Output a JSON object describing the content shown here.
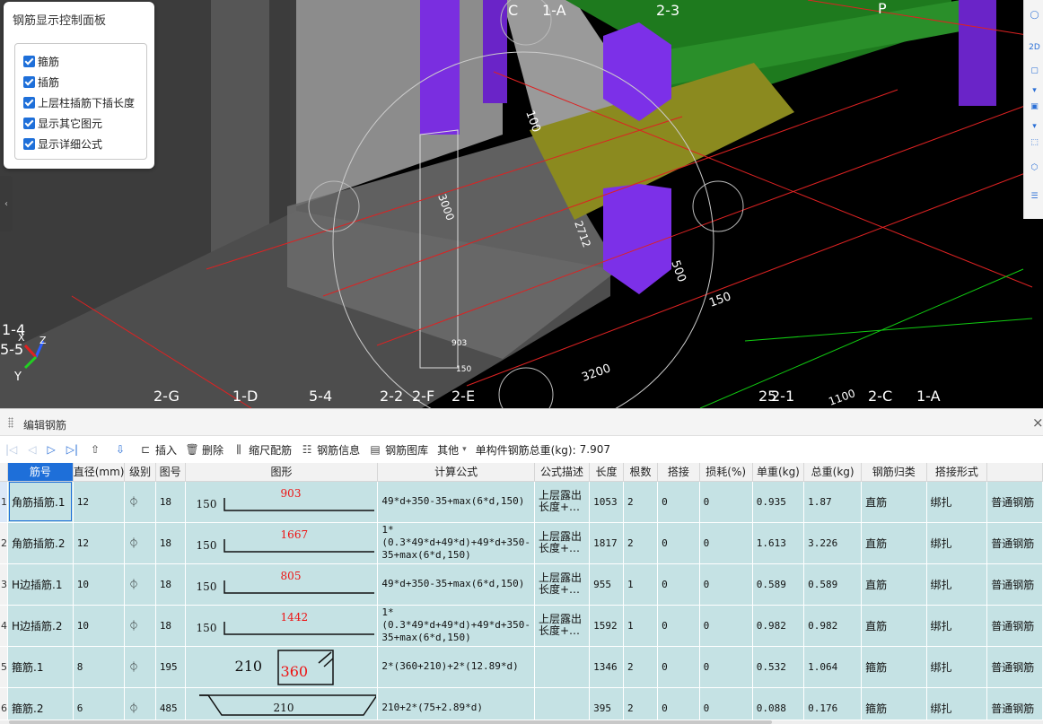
{
  "control_panel": {
    "title": "钢筋显示控制面板",
    "options": [
      {
        "label": "箍筋",
        "checked": true
      },
      {
        "label": "插筋",
        "checked": true
      },
      {
        "label": "上层柱插筋下插长度",
        "checked": true
      },
      {
        "label": "显示其它图元",
        "checked": true
      },
      {
        "label": "显示详细公式",
        "checked": true
      }
    ]
  },
  "viewport": {
    "axis_labels_bottom": [
      "2-G",
      "1-D",
      "5-4",
      "2-2",
      "2-F",
      "2-E",
      "2-1",
      "2-C",
      "1-A"
    ],
    "axis_label_25": "25",
    "axis_labels_top": [
      "C",
      "1-A",
      "2-3",
      "P"
    ],
    "axis_labels_left": [
      "1-4",
      "5-5"
    ],
    "triad": {
      "x": "X",
      "y": "Y",
      "z": "Z"
    },
    "dims": {
      "d903": "903",
      "d150": "150",
      "d500": "500",
      "d150b": "150",
      "d3200": "3200",
      "d100": "100",
      "d3000": "3000",
      "d2712": "2712",
      "d1100": "1100"
    },
    "right_toolbar": {
      "btn2d": "2D"
    }
  },
  "editor": {
    "title": "编辑钢筋",
    "close": "×",
    "toolbar": {
      "insert": "插入",
      "delete": "删除",
      "scale": "缩尺配筋",
      "info": "钢筋信息",
      "library": "钢筋图库",
      "other": "其他",
      "total_label": "单构件钢筋总重(kg):",
      "total_value": "7.907"
    },
    "columns": [
      "筋号",
      "直径(mm)",
      "级别",
      "图号",
      "图形",
      "计算公式",
      "公式描述",
      "长度",
      "根数",
      "搭接",
      "损耗(%)",
      "单重(kg)",
      "总重(kg)",
      "钢筋归类",
      "搭接形式",
      ""
    ],
    "rows": [
      {
        "n": "1",
        "name": "角筋插筋.1",
        "dia": "12",
        "grade": "⏀",
        "fig": "18",
        "shape_type": "L",
        "shape_a": "150",
        "shape_b": "903",
        "formula": "49*d+350-35+max(6*d,150)",
        "desc": "上层露出长度+…",
        "len": "1053",
        "count": "2",
        "lap": "0",
        "loss": "0",
        "unit": "0.935",
        "total": "1.87",
        "cat": "直筋",
        "lap_type": "绑扎",
        "type": "普通钢筋"
      },
      {
        "n": "2",
        "name": "角筋插筋.2",
        "dia": "12",
        "grade": "⏀",
        "fig": "18",
        "shape_type": "L",
        "shape_a": "150",
        "shape_b": "1667",
        "formula": "1*(0.3*49*d+49*d)+49*d+350-35+max(6*d,150)",
        "desc": "上层露出长度+…",
        "len": "1817",
        "count": "2",
        "lap": "0",
        "loss": "0",
        "unit": "1.613",
        "total": "3.226",
        "cat": "直筋",
        "lap_type": "绑扎",
        "type": "普通钢筋"
      },
      {
        "n": "3",
        "name": "H边插筋.1",
        "dia": "10",
        "grade": "⏀",
        "fig": "18",
        "shape_type": "L",
        "shape_a": "150",
        "shape_b": "805",
        "formula": "49*d+350-35+max(6*d,150)",
        "desc": "上层露出长度+…",
        "len": "955",
        "count": "1",
        "lap": "0",
        "loss": "0",
        "unit": "0.589",
        "total": "0.589",
        "cat": "直筋",
        "lap_type": "绑扎",
        "type": "普通钢筋"
      },
      {
        "n": "4",
        "name": "H边插筋.2",
        "dia": "10",
        "grade": "⏀",
        "fig": "18",
        "shape_type": "L",
        "shape_a": "150",
        "shape_b": "1442",
        "formula": "1*(0.3*49*d+49*d)+49*d+350-35+max(6*d,150)",
        "desc": "上层露出长度+…",
        "len": "1592",
        "count": "1",
        "lap": "0",
        "loss": "0",
        "unit": "0.982",
        "total": "0.982",
        "cat": "直筋",
        "lap_type": "绑扎",
        "type": "普通钢筋"
      },
      {
        "n": "5",
        "name": "箍筋.1",
        "dia": "8",
        "grade": "⏀",
        "fig": "195",
        "shape_type": "box",
        "shape_a": "210",
        "shape_b": "360",
        "formula": "2*(360+210)+2*(12.89*d)",
        "desc": "",
        "len": "1346",
        "count": "2",
        "lap": "0",
        "loss": "0",
        "unit": "0.532",
        "total": "1.064",
        "cat": "箍筋",
        "lap_type": "绑扎",
        "type": "普通钢筋"
      },
      {
        "n": "6",
        "name": "箍筋.2",
        "dia": "6",
        "grade": "⏀",
        "fig": "485",
        "shape_type": "trap",
        "shape_a": "210",
        "shape_b": "",
        "formula": "210+2*(75+2.89*d)",
        "desc": "",
        "len": "395",
        "count": "2",
        "lap": "0",
        "loss": "0",
        "unit": "0.088",
        "total": "0.176",
        "cat": "箍筋",
        "lap_type": "绑扎",
        "type": "普通钢筋"
      }
    ]
  }
}
